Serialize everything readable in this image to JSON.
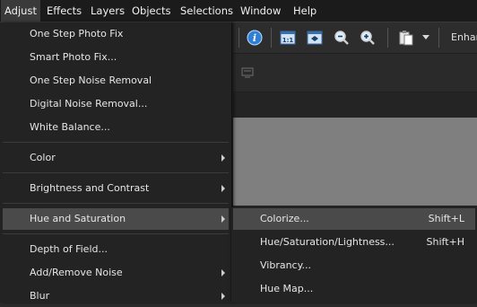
{
  "menubar": {
    "items": [
      {
        "label": "Adjust",
        "active": true
      },
      {
        "label": "Effects"
      },
      {
        "label": "Layers"
      },
      {
        "label": "Objects"
      },
      {
        "label": "Selections"
      },
      {
        "label": "Window"
      },
      {
        "label": "Help"
      }
    ]
  },
  "toolbar": {
    "icons": [
      "info-icon",
      "actual-size-icon",
      "fit-window-icon",
      "zoom-out-icon",
      "zoom-in-icon",
      "paste-icon",
      "dropdown-arrow-icon"
    ],
    "enhance_label": "Enhar"
  },
  "adjust_menu": {
    "items": [
      {
        "label": "One Step Photo Fix"
      },
      {
        "label": "Smart Photo Fix..."
      },
      {
        "label": "One Step Noise Removal"
      },
      {
        "label": "Digital Noise Removal..."
      },
      {
        "label": "White Balance..."
      },
      {
        "label": "Color",
        "submenu": true
      },
      {
        "label": "Brightness and Contrast",
        "submenu": true
      },
      {
        "label": "Hue and Saturation",
        "submenu": true,
        "highlighted": true
      },
      {
        "label": "Depth of Field..."
      },
      {
        "label": "Add/Remove Noise",
        "submenu": true
      },
      {
        "label": "Blur",
        "submenu": true
      }
    ]
  },
  "hue_submenu": {
    "items": [
      {
        "label": "Colorize...",
        "shortcut": "Shift+L",
        "highlighted": true
      },
      {
        "label": "Hue/Saturation/Lightness...",
        "shortcut": "Shift+H"
      },
      {
        "label": "Vibrancy...",
        "shortcut": ""
      },
      {
        "label": "Hue Map...",
        "shortcut": ""
      }
    ]
  },
  "colors": {
    "canvas_gray": "#7f7f7f",
    "menu_bg": "#232323",
    "highlight": "#4a4a4a",
    "icon_blue": "#2f7fd6"
  }
}
